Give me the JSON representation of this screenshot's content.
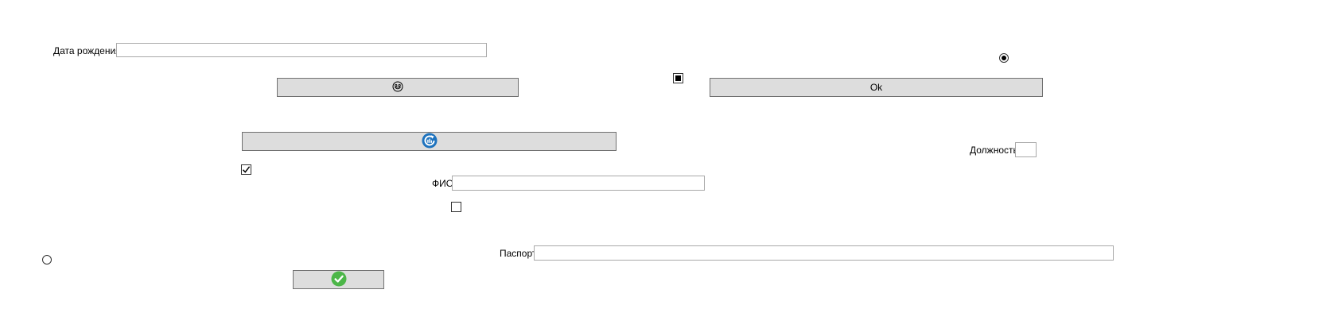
{
  "form": {
    "birth_date_label": "Дата рождения",
    "birth_date_value": "",
    "fio_label": "ФИО",
    "fio_value": "",
    "position_label": "Должность",
    "position_value": "",
    "passport_label": "Паспорт",
    "passport_value": "",
    "ok_button_label": "Ok"
  },
  "controls": {
    "checkbox_checked": true,
    "checkbox_unchecked": false,
    "checkbox_indeterminate": "indeterminate",
    "radio_top_selected": true,
    "radio_left_selected": false
  },
  "icons": {
    "emoji_button_icon": "emoji-face-icon",
    "refresh_button_icon": "refresh-icon",
    "confirm_button_icon": "checkmark-icon"
  },
  "colors": {
    "button_bg": "#dddddd",
    "refresh_icon": "#1e73be",
    "confirm_icon": "#4cb648"
  }
}
